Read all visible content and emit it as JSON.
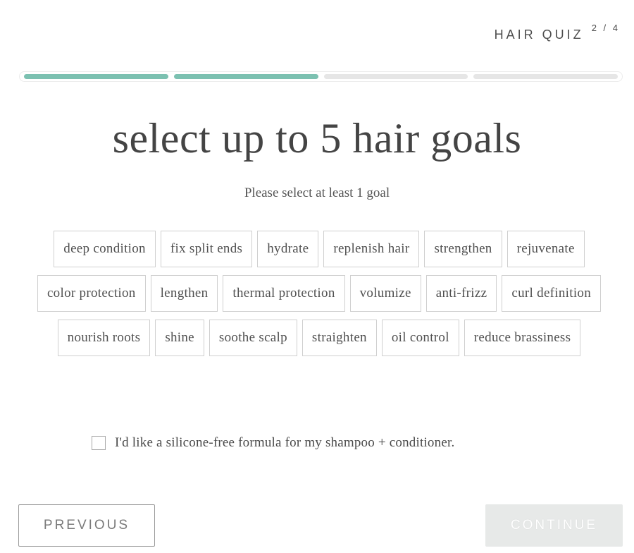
{
  "header": {
    "title": "HAIR QUIZ",
    "step": "2 / 4"
  },
  "progress": {
    "total_steps": 4,
    "completed_steps": 2,
    "colors": {
      "done": "#7cc1b1",
      "pending": "#e6e6e6"
    }
  },
  "main": {
    "title": "select up to 5 hair goals",
    "subtitle": "Please select at least 1 goal",
    "max_selections": 5,
    "goals": [
      "deep condition",
      "fix split ends",
      "hydrate",
      "replenish hair",
      "strengthen",
      "rejuvenate",
      "color protection",
      "lengthen",
      "thermal protection",
      "volumize",
      "anti-frizz",
      "curl definition",
      "nourish roots",
      "shine",
      "soothe scalp",
      "straighten",
      "oil control",
      "reduce brassiness"
    ],
    "silicone_free": {
      "label": "I'd like a silicone-free formula for my shampoo + conditioner.",
      "checked": false
    }
  },
  "footer": {
    "previous_label": "PREVIOUS",
    "continue_label": "CONTINUE",
    "continue_disabled": true
  }
}
